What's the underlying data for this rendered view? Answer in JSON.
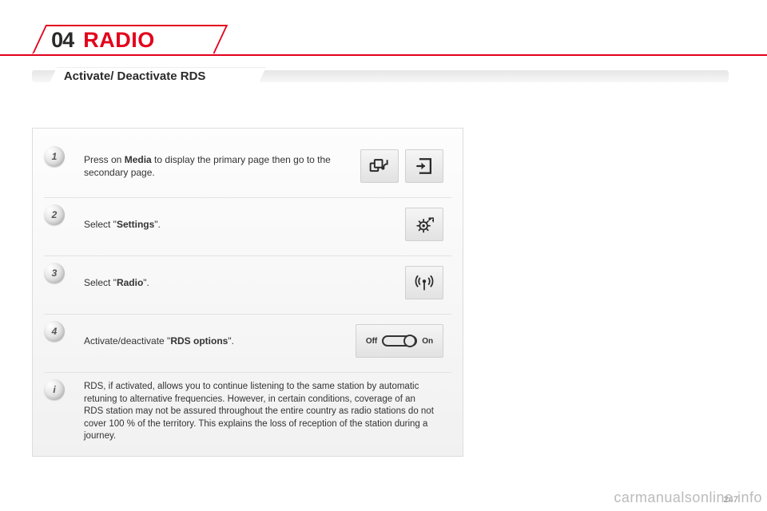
{
  "chapter": {
    "num": "04",
    "title": "RADIO"
  },
  "section": {
    "title": "Activate/ Deactivate RDS"
  },
  "steps": [
    {
      "badge": "1",
      "pre": "Press on ",
      "bold": "Media",
      "post": " to display the primary page then go to the secondary page."
    },
    {
      "badge": "2",
      "pre": "Select \"",
      "bold": "Settings",
      "post": "\"."
    },
    {
      "badge": "3",
      "pre": "Select \"",
      "bold": "Radio",
      "post": "\"."
    },
    {
      "badge": "4",
      "pre": "Activate/deactivate \"",
      "bold": "RDS options",
      "post": "\"."
    }
  ],
  "info": {
    "badge": "i",
    "text": "RDS, if activated, allows you to continue listening to the same station by automatic retuning to alternative frequencies. However, in certain conditions, coverage of an RDS station may not be assured throughout the entire country as radio stations do not cover 100 % of the territory. This explains the loss of reception of the station during a journey."
  },
  "toggle": {
    "off": "Off",
    "on": "On"
  },
  "watermark": "carmanualsonline.info",
  "page_number": "247"
}
